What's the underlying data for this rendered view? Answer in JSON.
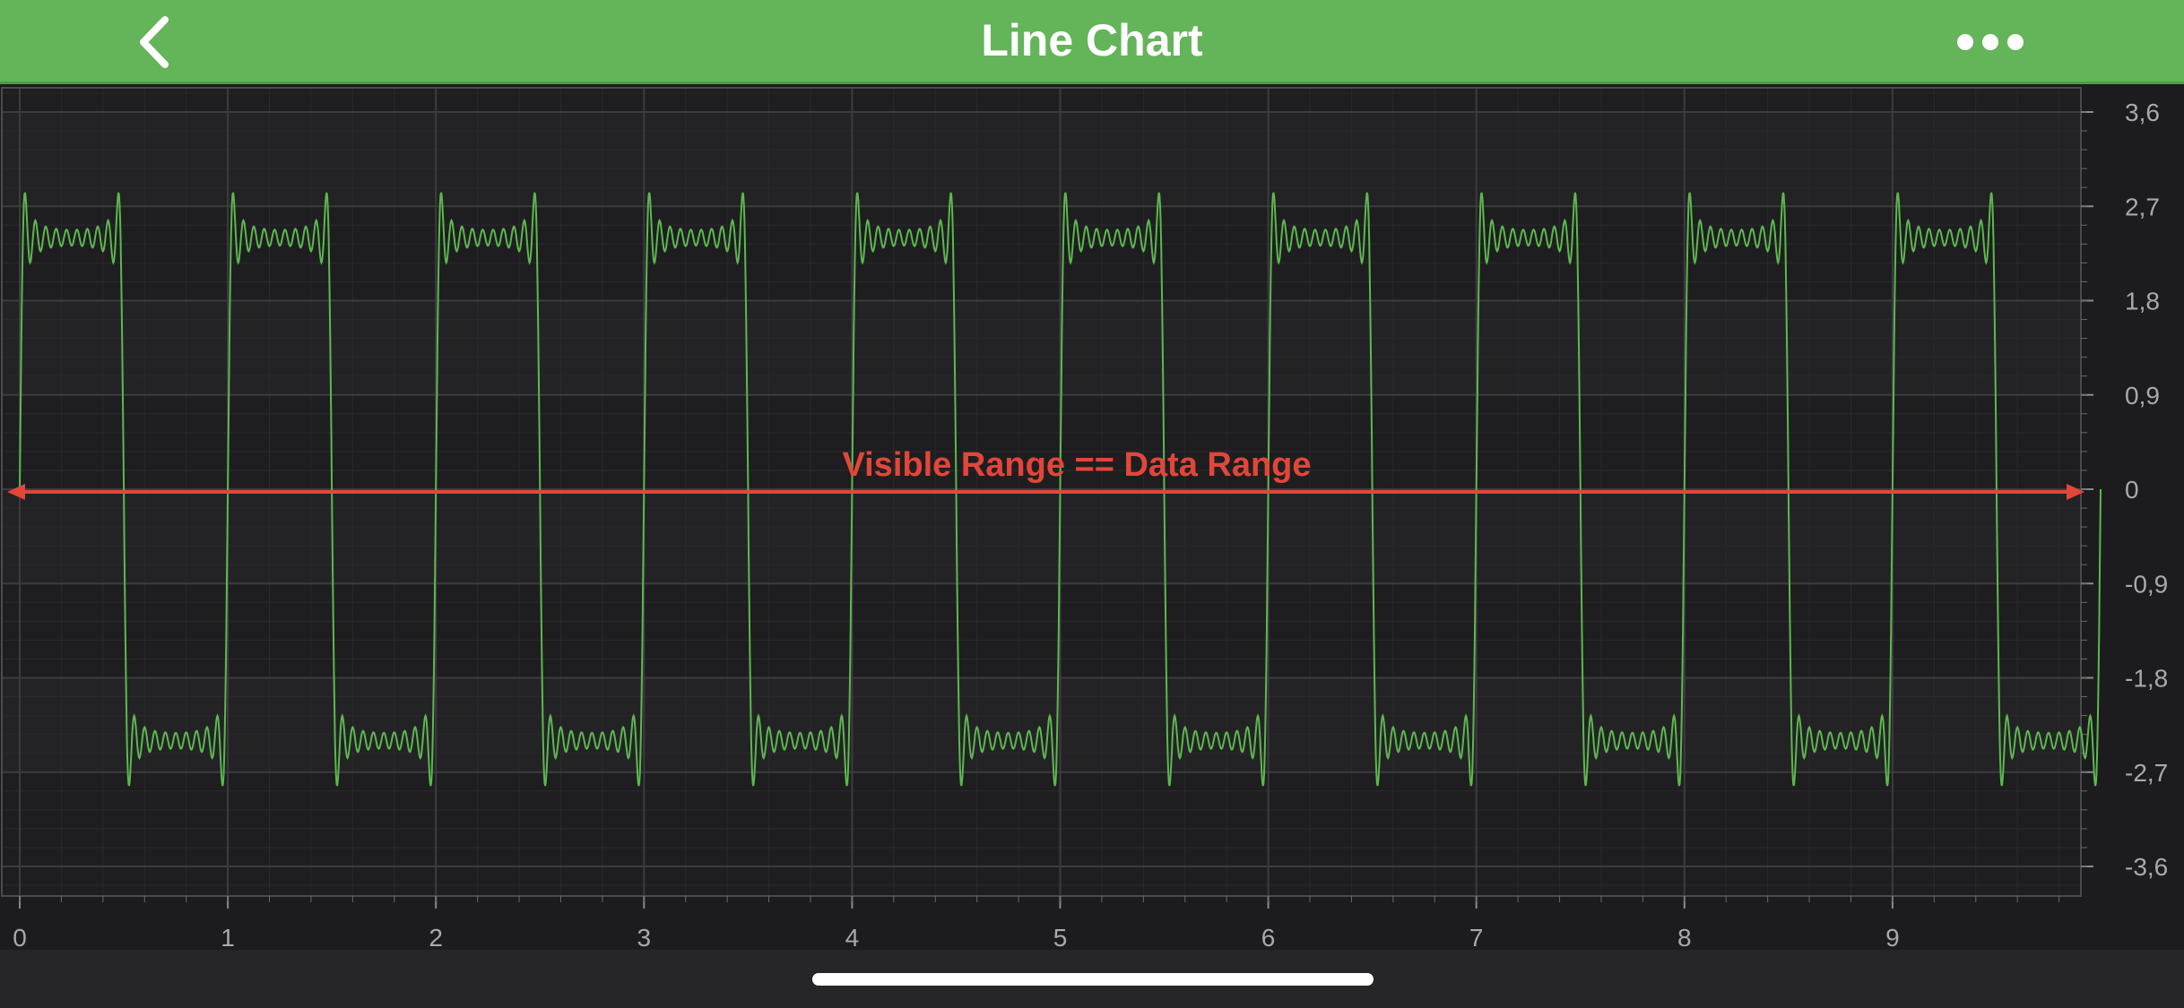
{
  "nav": {
    "title": "Line Chart",
    "back_icon": "chevron-left-icon",
    "more_icon": "more-horizontal-icon",
    "bar_color": "#64b45a"
  },
  "chart_data": {
    "type": "line",
    "title": "",
    "xlabel": "",
    "ylabel": "",
    "x_ticks": [
      "0",
      "1",
      "2",
      "3",
      "4",
      "5",
      "6",
      "7",
      "8",
      "9"
    ],
    "y_ticks": [
      "3,6",
      "2,7",
      "1,8",
      "0,9",
      "0",
      "-0,9",
      "-1,8",
      "-2,7",
      "-3,6"
    ],
    "xlim": [
      0,
      10
    ],
    "ylim": [
      -3.6,
      3.6
    ],
    "grid": true,
    "y_axis_position": "right",
    "series": [
      {
        "color": "#5cb84e",
        "description_of_signal": "",
        "x": [
          0,
          0.02,
          0.04,
          0.06,
          0.08,
          0.1,
          0.12,
          0.14,
          0.16,
          0.18,
          0.2,
          0.22,
          0.24,
          0.26,
          0.28,
          0.3,
          0.32,
          0.34,
          0.36,
          0.38,
          0.4,
          0.42,
          0.44,
          0.46,
          0.48,
          0.5,
          0.52,
          0.54,
          0.56,
          0.58,
          0.6,
          0.62,
          0.64,
          0.66,
          0.68,
          0.7,
          0.72,
          0.74,
          0.76,
          0.78,
          0.8,
          0.82,
          0.84,
          0.86,
          0.88,
          0.9,
          0.92,
          0.94,
          0.96,
          0.98,
          1
        ],
        "y": [
          0,
          3.25,
          2.5,
          2.75,
          2.4,
          2.65,
          2.45,
          2.6,
          2.4,
          2.55,
          2.3,
          2.5,
          2.2,
          2.45,
          2.1,
          2.55,
          2.2,
          2.4,
          2.3,
          2.5,
          2.6,
          2.1,
          2.05,
          0.5,
          -1.5,
          -3.0,
          -2.3,
          -2.7,
          -2.4,
          -2.6,
          -2.45,
          -2.55,
          -2.4,
          -2.6,
          -2.35,
          -2.6,
          -2.3,
          -2.55,
          -2.2,
          -2.6,
          -2.1,
          -2.55,
          -2.0,
          -2.6,
          -1.9,
          -2.65,
          -1.5,
          -2.4,
          0.0,
          2.0,
          3.25
        ],
        "period": 1,
        "cycles": 10
      }
    ],
    "annotation": {
      "text": "Visible Range == Data Range",
      "y": 0,
      "x_start": 0,
      "x_end": 10,
      "color": "#e2463a"
    }
  }
}
